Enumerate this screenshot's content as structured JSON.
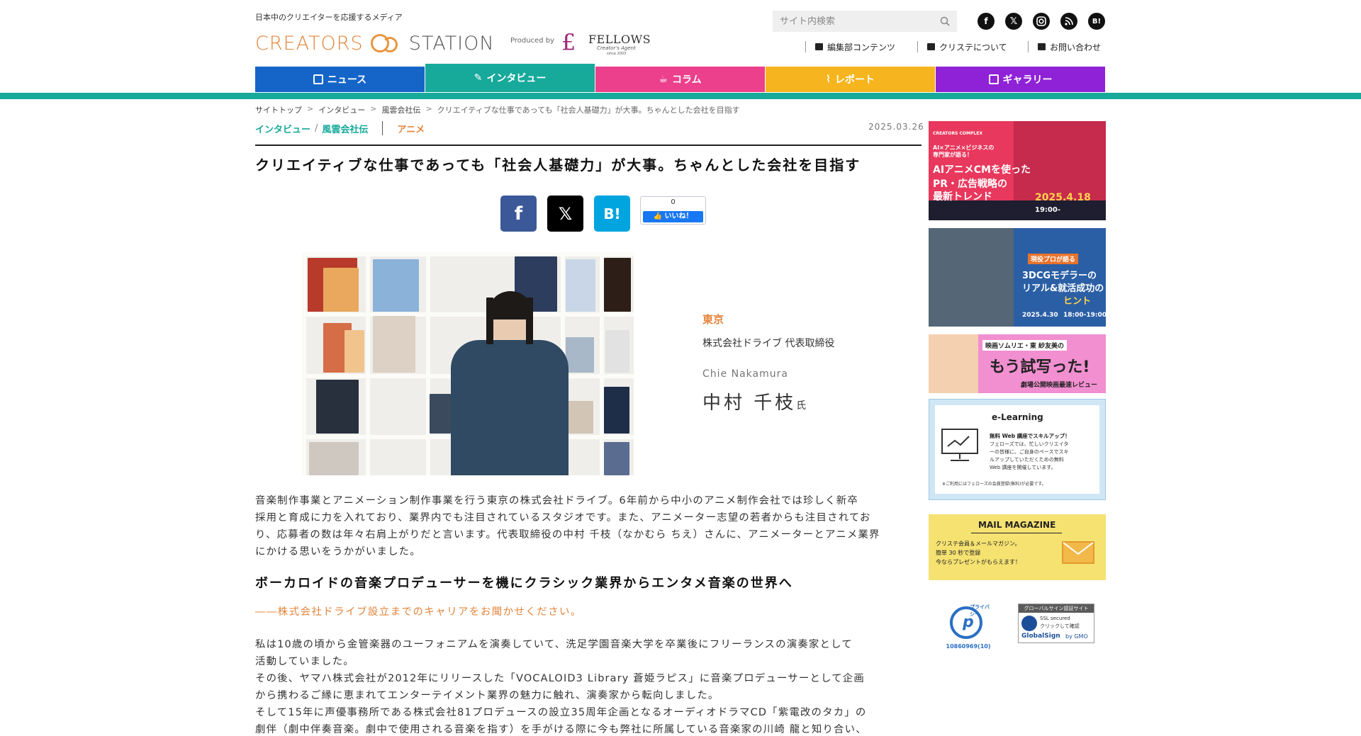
{
  "site": {
    "tagline": "日本中のクリエイターを応援するメディア",
    "logo_left": "CREATORS",
    "logo_right": "STATION",
    "produced_by": "Produced by",
    "fellows_name": "FELLOWS",
    "fellows_sub": "Creator's Agent",
    "fellows_since": "since 2003"
  },
  "search": {
    "placeholder": "サイト内検索"
  },
  "header_links": {
    "editorial": "編集部コンテンツ",
    "about": "クリステについて",
    "contact": "お問い合わせ"
  },
  "nav": {
    "tabs": [
      {
        "label": "ニュース",
        "color": "#1565c8"
      },
      {
        "label": "インタビュー",
        "color": "#17a99a"
      },
      {
        "label": "コラム",
        "color": "#ec3f8c"
      },
      {
        "label": "レポート",
        "color": "#f6b51e"
      },
      {
        "label": "ギャラリー",
        "color": "#8f22d6"
      }
    ]
  },
  "breadcrumb": {
    "items": [
      "サイトトップ",
      "インタビュー",
      "風雲会社伝"
    ],
    "current": "クリエイティブな仕事であっても「社会人基礎力」が大事。ちゃんとした会社を目指す"
  },
  "article": {
    "category": "インタビュー",
    "subcategory": "風雲会社伝",
    "tag": "アニメ",
    "date": "2025.03.26",
    "title": "クリエイティブな仕事であっても「社会人基礎力」が大事。ちゃんとした会社を目指す",
    "like_count": "0",
    "like_label": "いいね！",
    "profile": {
      "location": "東京",
      "company": "株式会社ドライブ 代表取締役",
      "roman": "Chie Nakamura",
      "name": "中村 千枝",
      "honorific": "氏"
    },
    "lead": [
      "音楽制作事業とアニメーション制作事業を行う東京の株式会社ドライブ。6年前から中小のアニメ制作会社では珍しく新卒",
      "採用と育成に力を入れており、業界内でも注目されているスタジオです。また、アニメーター志望の若者からも注目されてお",
      "り、応募者の数は年々右肩上がりだと言います。代表取締役の中村 千枝（なかむら ちえ）さんに、アニメーターとアニメ業界",
      "にかける思いをうかがいました。"
    ],
    "heading": "ボーカロイドの音楽プロデューサーを機にクラシック業界からエンタメ音楽の世界へ",
    "question": "――株式会社ドライブ設立までのキャリアをお聞かせください。",
    "answer": [
      "私は10歳の頃から金管楽器のユーフォニアムを演奏していて、洗足学園音楽大学を卒業後にフリーランスの演奏家として",
      "活動していました。",
      "その後、ヤマハ株式会社が2012年にリリースした「VOCALOID3 Library 蒼姫ラピス」に音楽プロデューサーとして企画",
      "から携わるご縁に恵まれてエンターテイメント業界の魅力に触れ、演奏家から転向しました。",
      "そして15年に声優事務所である株式会社81プロデュースの設立35周年企画となるオーディオドラマCD「紫電改のタカ」の",
      "劇伴（劇中伴奏音楽。劇中で使用される音楽を指す）を手がける際に今も弊社に所属している音楽家の川崎 龍と知り合い、"
    ]
  },
  "sidebar": {
    "banner1": {
      "lines": [
        "CREATORS COMPLEX",
        "AI×アニメ×ビジネスの",
        "専門家が語る！",
        "AIアニメCMを使った",
        "PR・広告戦略の",
        "最新トレンド",
        "2025.4.18",
        "19:00-"
      ]
    },
    "banner2": {
      "lines": [
        "現役プロが語る",
        "3DCGモデラーの",
        "リアル&就活成功の",
        "ヒント",
        "2025.4.30",
        "18:00-19:00"
      ]
    },
    "banner3": {
      "lines": [
        "映画ソムリエ・東 紗友美の",
        "もう試写った!",
        "劇場公開映画最速レビュー"
      ]
    },
    "banner4": {
      "lines": [
        "e-Learning",
        "無料 Web 講座でスキルアップ！",
        "フェローズでは、忙しいクリエイタ",
        "ーの皆様に、ご自身のペースでスキ",
        "ルアップしていただくための無料",
        "Web 講座を開催しています。",
        "※ご利用にはフェローズの会員登録(無料)が必要です。"
      ]
    },
    "banner5": {
      "lines": [
        "MAIL MAGAZINE",
        "クリステ会員＆メールマガジン。",
        "簡単 30 秒で登録",
        "今ならプレゼントがもらえます！"
      ]
    },
    "privacy": {
      "label": "プライバシー",
      "id": "10860969(10)"
    },
    "globalsign": {
      "top": "グローバルサイン認証サイト",
      "mid": "SSL secured",
      "click": "クリックして確認",
      "brand": "GlobalSign",
      "by": "by GMO"
    }
  },
  "colors": {
    "accent": "#17a99a",
    "orange": "#e3843a"
  }
}
